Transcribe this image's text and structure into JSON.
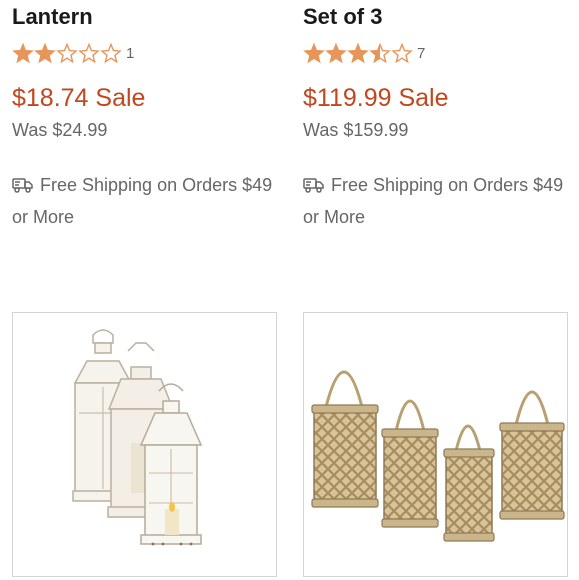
{
  "products": [
    {
      "title": "Lantern",
      "rating": 2,
      "rating_max": 5,
      "review_count": "1",
      "price": "$18.74 Sale",
      "was": "Was $24.99",
      "shipping": "Free Shipping on Orders $49 or More"
    },
    {
      "title": "Set of 3",
      "rating": 3.5,
      "rating_max": 5,
      "review_count": "7",
      "price": "$119.99 Sale",
      "was": "Was $159.99",
      "shipping": "Free Shipping on Orders $49 or More"
    }
  ],
  "colors": {
    "star": "#e8955a",
    "sale_price": "#c1471f",
    "muted_text": "#666666",
    "border": "#d4d4d4"
  },
  "icons": {
    "shipping": "truck-icon",
    "rating": "star-icon"
  }
}
